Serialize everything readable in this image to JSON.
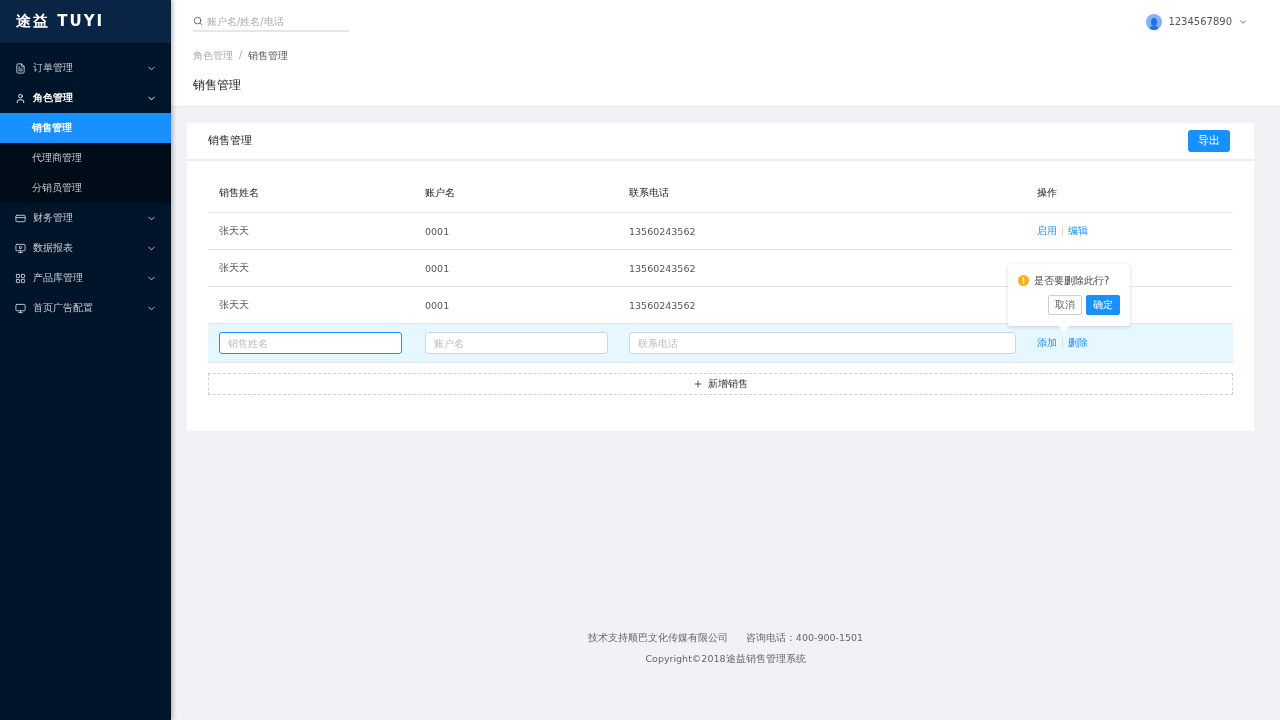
{
  "logo": {
    "text": "途益 TUYI"
  },
  "sidebar": {
    "items": [
      {
        "label": "订单管理",
        "expanded": false
      },
      {
        "label": "角色管理",
        "expanded": true,
        "children": [
          {
            "label": "销售管理",
            "selected": true
          },
          {
            "label": "代理商管理",
            "selected": false
          },
          {
            "label": "分销员管理",
            "selected": false
          }
        ]
      },
      {
        "label": "财务管理",
        "expanded": false
      },
      {
        "label": "数据报表",
        "expanded": false
      },
      {
        "label": "产品库管理",
        "expanded": false
      },
      {
        "label": "首页广告配置",
        "expanded": false
      }
    ]
  },
  "search": {
    "placeholder": "账户名/姓名/电话"
  },
  "user": {
    "name": "1234567890"
  },
  "breadcrumb": {
    "items": [
      "角色管理",
      "销售管理"
    ],
    "separator": "/"
  },
  "page_title": "销售管理",
  "card": {
    "title": "销售管理",
    "export_button": "导出",
    "table": {
      "columns": [
        "销售姓名",
        "账户名",
        "联系电话",
        "操作"
      ],
      "rows": [
        {
          "name": "张天天",
          "account": "0001",
          "phone": "13560243562",
          "actions": [
            "启用",
            "编辑"
          ]
        },
        {
          "name": "张天天",
          "account": "0001",
          "phone": "13560243562"
        },
        {
          "name": "张天天",
          "account": "0001",
          "phone": "13560243562"
        }
      ],
      "new_row": {
        "placeholders": [
          "销售姓名",
          "账户名",
          "联系电话"
        ],
        "actions": [
          "添加",
          "删除"
        ],
        "popover": {
          "message": "是否要删除此行?",
          "cancel": "取消",
          "confirm": "确定"
        }
      }
    },
    "add_button": "新增销售"
  },
  "footer": {
    "lines": [
      "技术支持顺巴文化传媒有限公司",
      "咨询电话：400-900-1501",
      "Copyright©2018途益销售管理系统"
    ]
  }
}
